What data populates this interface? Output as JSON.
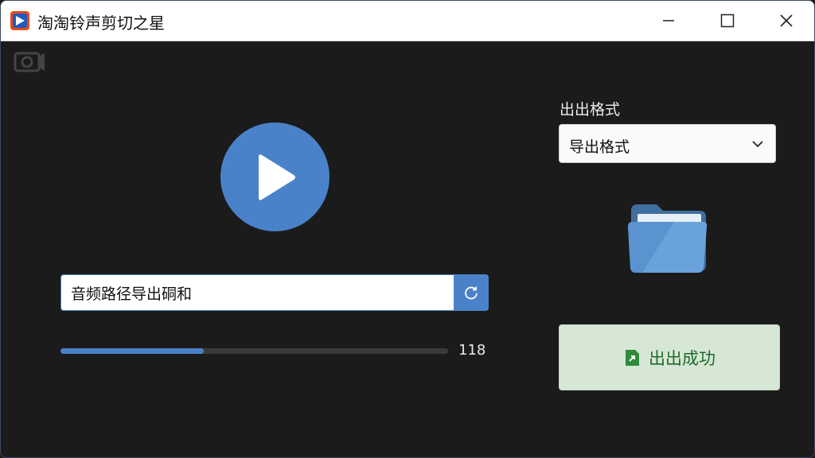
{
  "window": {
    "title": "淘淘铃声剪切之星",
    "controls": {
      "minimize": "minimize",
      "maximize": "maximize",
      "close": "close"
    }
  },
  "player": {
    "play_icon": "play-icon"
  },
  "path_input": {
    "value": "音频路径导出硐和",
    "refresh_icon": "refresh-icon"
  },
  "progress": {
    "percent": 37,
    "value_text": "118"
  },
  "export": {
    "format_label": "出出格式",
    "format_selected": "导出格式",
    "folder_icon": "folder-icon",
    "success_label": "出出成功",
    "success_icon": "export-success-icon"
  },
  "colors": {
    "accent": "#4a82c9",
    "success_bg": "#d6e7d5",
    "success_text": "#1f6b2a",
    "background": "#1b1b1b"
  }
}
